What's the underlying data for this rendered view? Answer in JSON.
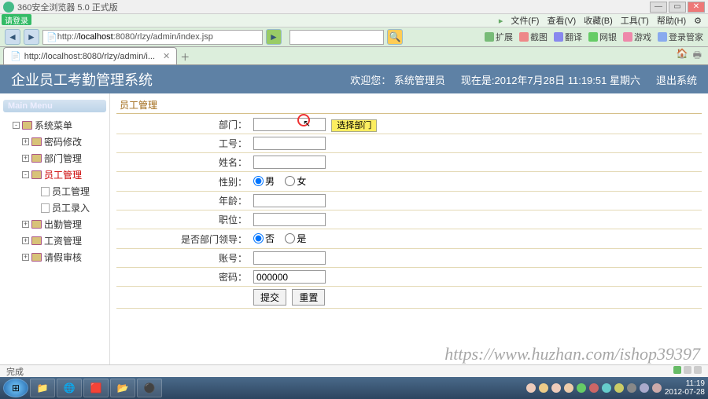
{
  "browser": {
    "title": "360安全浏览器 5.0 正式版",
    "badge": "请登录",
    "menu": [
      "文件(F)",
      "查看(V)",
      "收藏(B)",
      "工具(T)",
      "帮助(H)"
    ],
    "url_prefix": "http://",
    "url_host": "localhost",
    "url_rest": ":8080/rlzy/admin/index.jsp",
    "tab_label": "http://localhost:8080/rlzy/admin/i...",
    "toolbar": [
      "扩展",
      "截图",
      "翻译",
      "网银",
      "游戏",
      "登录管家"
    ]
  },
  "header": {
    "title": "企业员工考勤管理系统",
    "welcome": "欢迎您：",
    "user": "系统管理员",
    "now_label": "现在是:",
    "now": "2012年7月28日  11:19:51 星期六",
    "logout": "退出系统"
  },
  "sidebar": {
    "menu_title": "Main Menu",
    "root": "系统菜单",
    "items": [
      {
        "label": "密码修改",
        "expand": "+"
      },
      {
        "label": "部门管理",
        "expand": "+"
      },
      {
        "label": "员工管理",
        "expand": "-",
        "children": [
          {
            "label": "员工管理"
          },
          {
            "label": "员工录入"
          }
        ]
      },
      {
        "label": "出勤管理",
        "expand": "+"
      },
      {
        "label": "工资管理",
        "expand": "+"
      },
      {
        "label": "请假审核",
        "expand": "+"
      }
    ]
  },
  "content": {
    "panel_title": "员工管理",
    "fields": {
      "dept": {
        "label": "部门：",
        "value": "",
        "select_btn": "选择部门"
      },
      "empno": {
        "label": "工号：",
        "value": ""
      },
      "name": {
        "label": "姓名：",
        "value": ""
      },
      "gender": {
        "label": "性别：",
        "opt1": "男",
        "opt2": "女",
        "value": "男"
      },
      "age": {
        "label": "年龄：",
        "value": ""
      },
      "position": {
        "label": "职位：",
        "value": ""
      },
      "leader": {
        "label": "是否部门领导：",
        "opt1": "否",
        "opt2": "是",
        "value": "否"
      },
      "account": {
        "label": "账号：",
        "value": ""
      },
      "password": {
        "label": "密码：",
        "value": "000000"
      }
    },
    "actions": {
      "submit": "提交",
      "reset": "重置"
    }
  },
  "statusbar": {
    "left": "完成",
    "right": ""
  },
  "taskbar": {
    "time": "11:19",
    "date": "2012-07-28"
  },
  "watermark": "https://www.huzhan.com/ishop39397"
}
